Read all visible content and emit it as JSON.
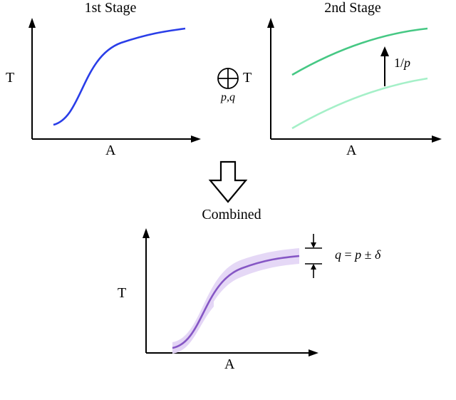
{
  "panel1": {
    "title": "1st Stage",
    "xlabel": "A",
    "ylabel": "T"
  },
  "panel2": {
    "title": "2nd Stage",
    "xlabel": "A",
    "ylabel": "T",
    "arrow_label": "1/p"
  },
  "combine_op": {
    "label": "p,q"
  },
  "panel3": {
    "title": "Combined",
    "xlabel": "A",
    "ylabel": "T",
    "equation": "q = p ± δ"
  },
  "colors": {
    "axis": "#000000",
    "curve1": "#2a3ee8",
    "curve2_low": "#a5f0c8",
    "curve2_high": "#46c884",
    "curve3": "#8657c5",
    "band3": "#e2d4f5"
  }
}
